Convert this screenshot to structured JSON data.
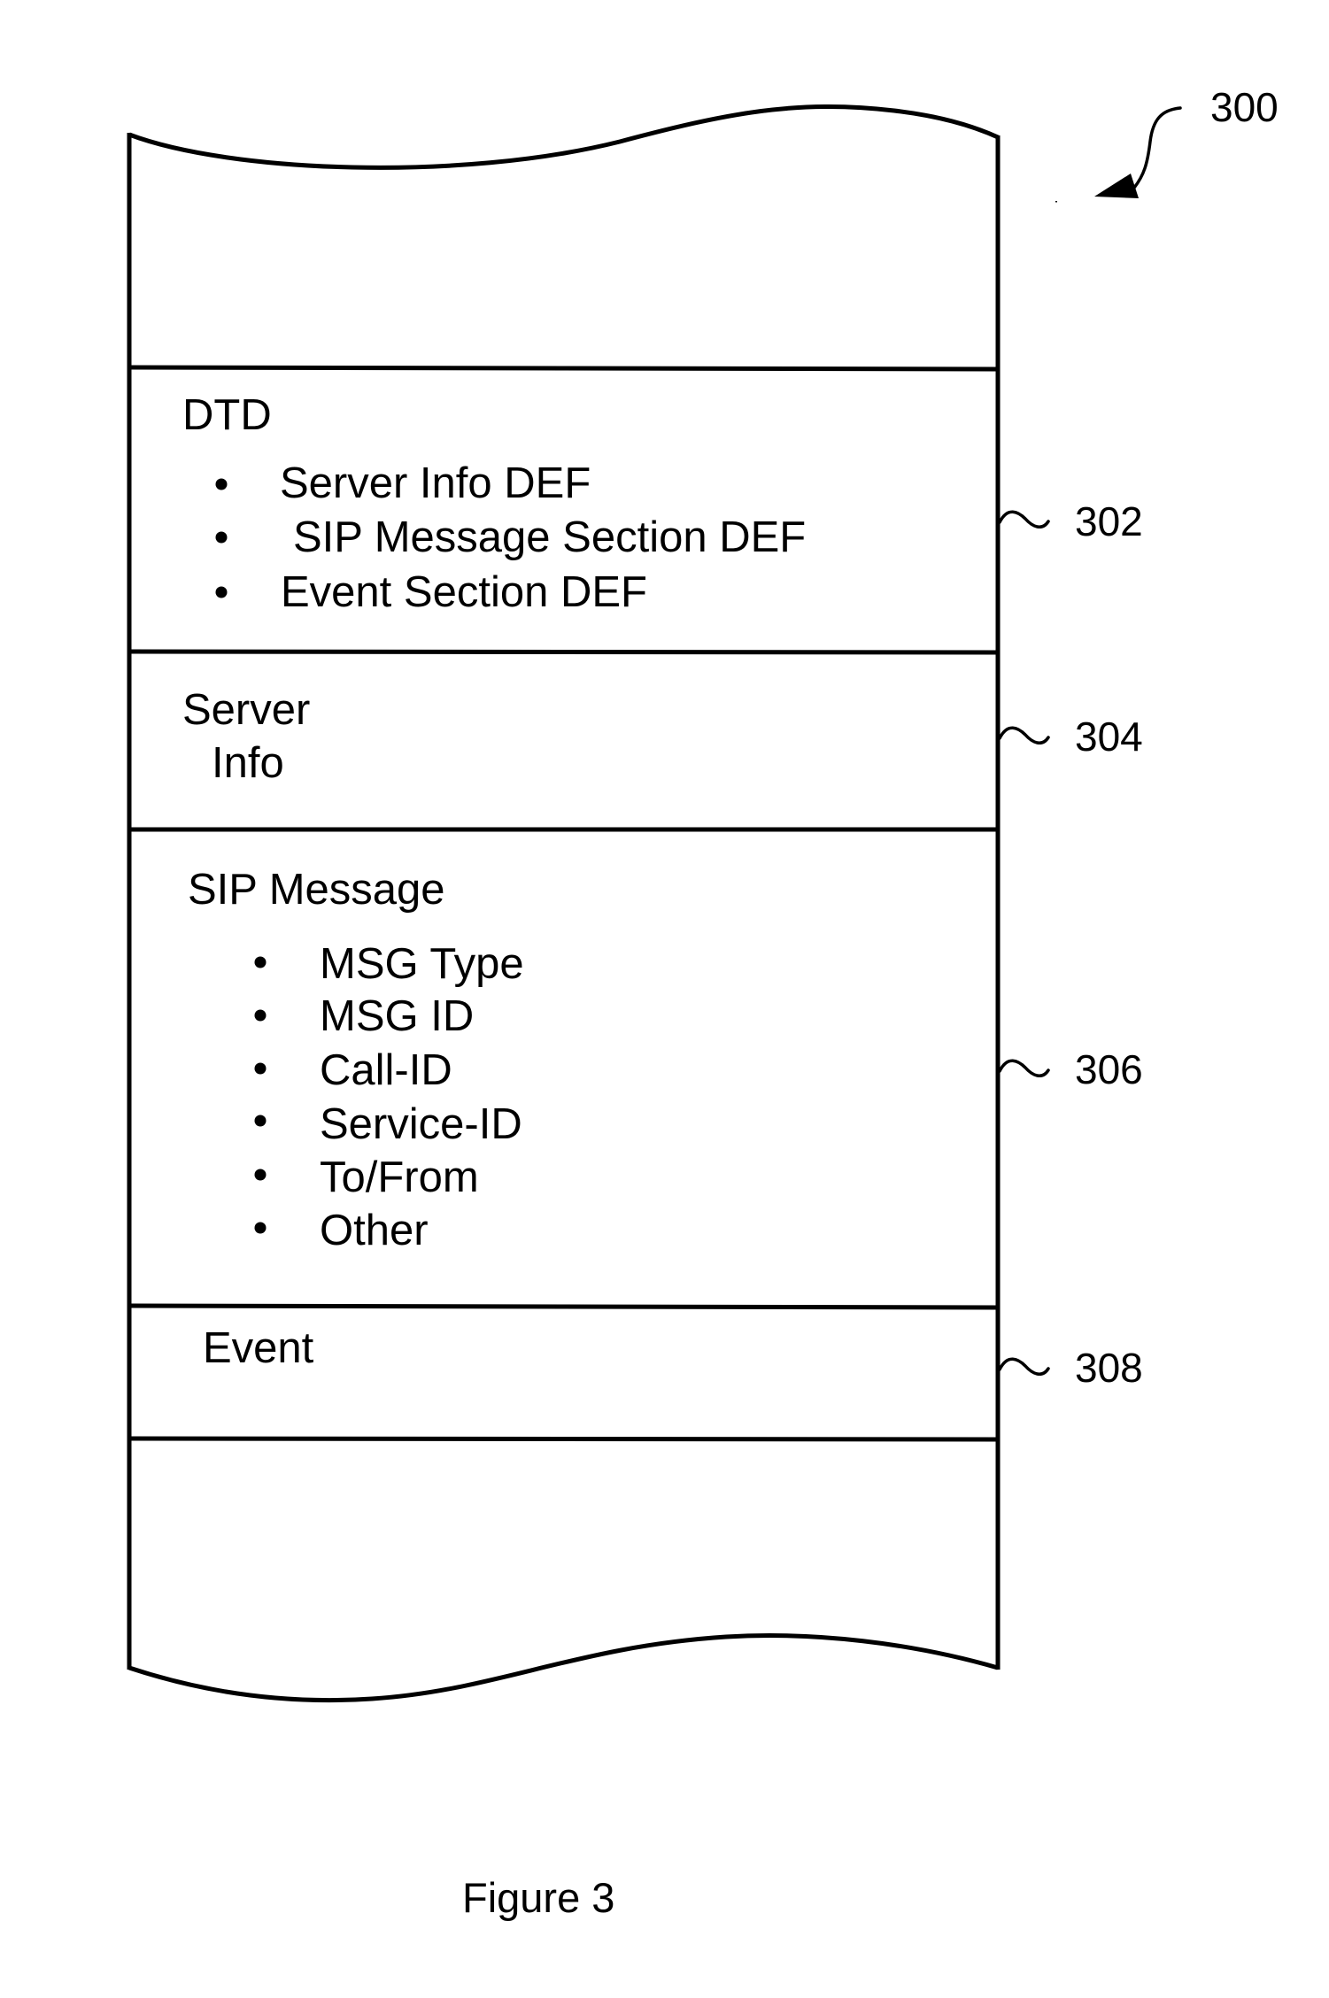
{
  "figure": {
    "reference_number": "300",
    "caption": "Figure 3"
  },
  "sections": [
    {
      "ref": "302",
      "title": "DTD",
      "items": [
        "Server Info DEF",
        "SIP Message Section DEF",
        "Event Section DEF"
      ]
    },
    {
      "ref": "304",
      "title_lines": [
        "Server",
        "Info"
      ]
    },
    {
      "ref": "306",
      "title": "SIP Message",
      "items": [
        "MSG Type",
        "MSG ID",
        "Call-ID",
        "Service-ID",
        "To/From",
        "Other"
      ]
    },
    {
      "ref": "308",
      "title": "Event"
    }
  ]
}
